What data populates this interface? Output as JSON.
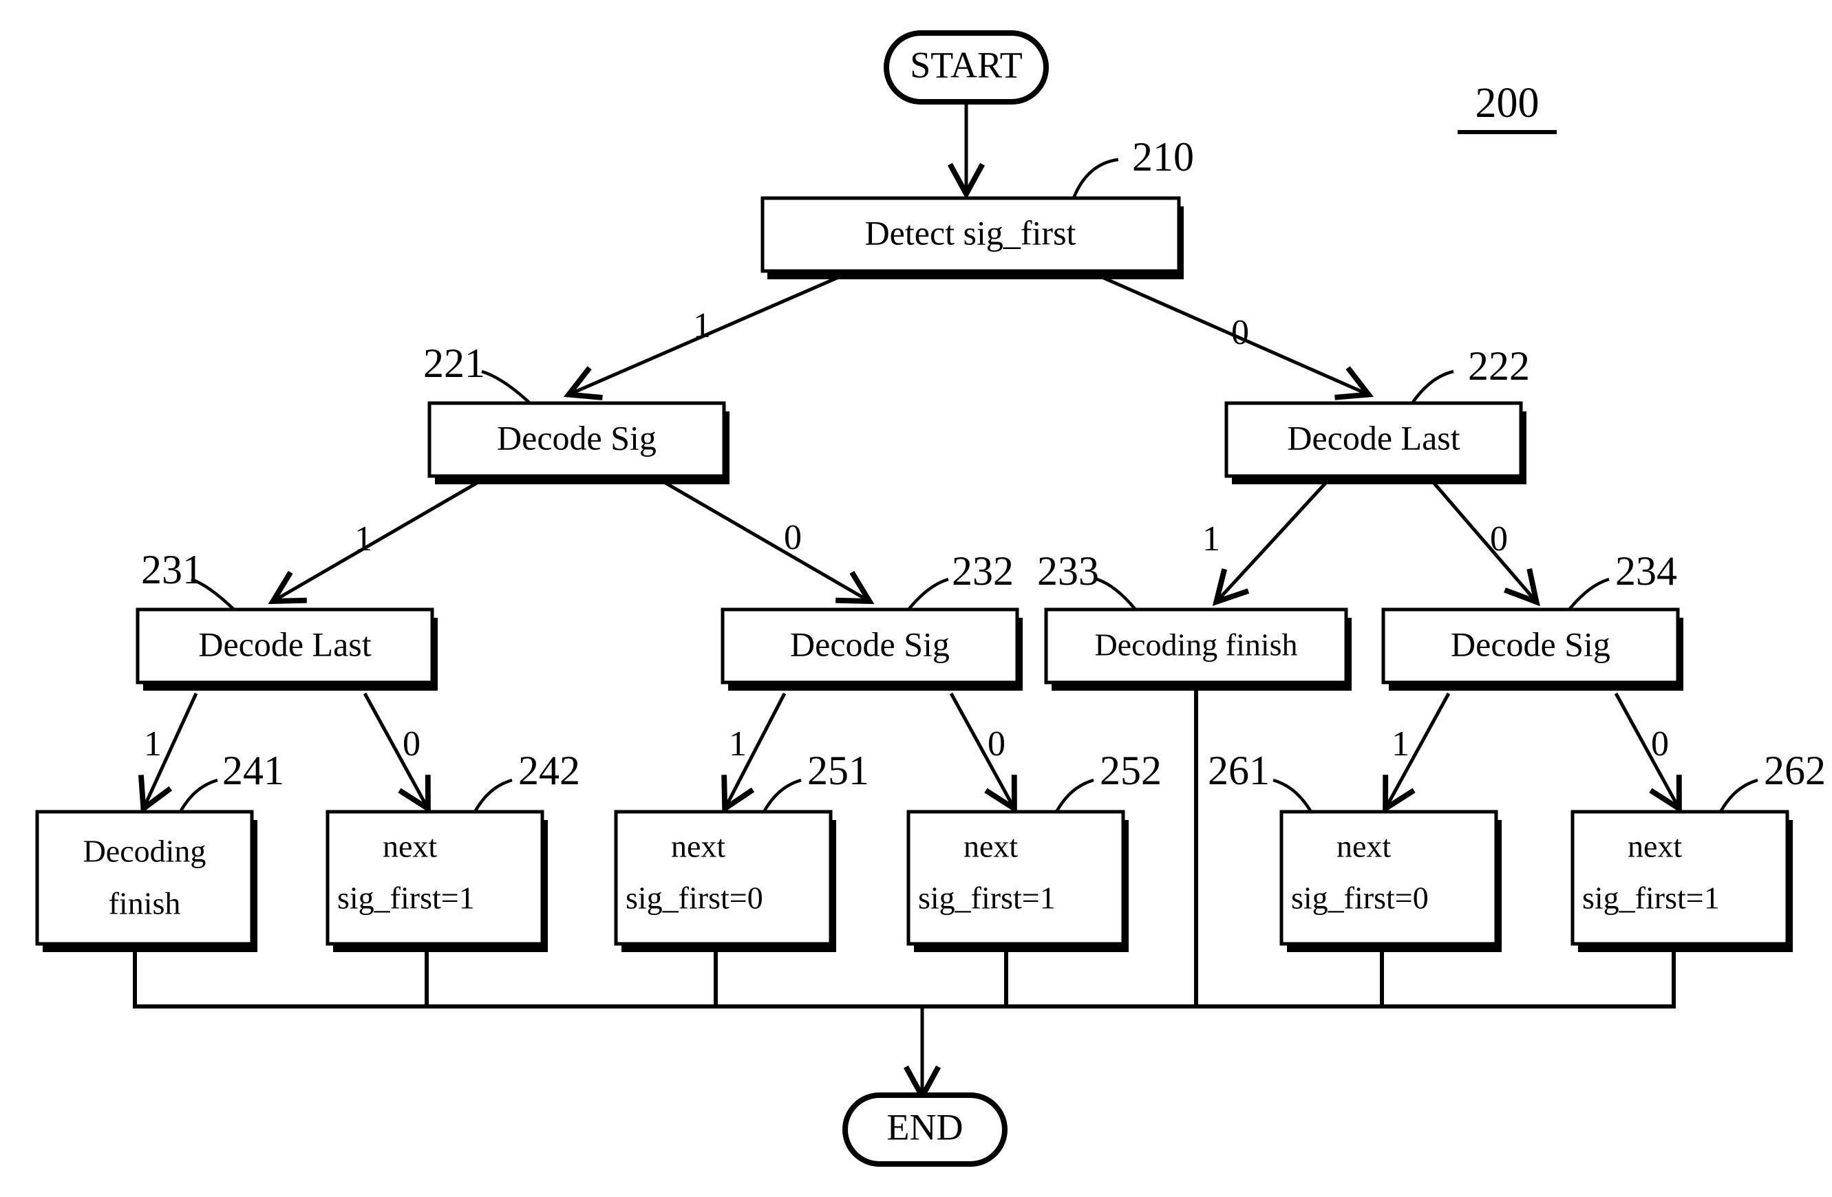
{
  "figure": {
    "number": "200",
    "title_underlined": true
  },
  "terminals": {
    "start": "START",
    "end": "END"
  },
  "nodes": [
    {
      "id": "210",
      "ref": "210",
      "label": "Detect sig_first",
      "lines": [
        "Detect sig_first"
      ]
    },
    {
      "id": "221",
      "ref": "221",
      "label": "Decode Sig",
      "lines": [
        "Decode Sig"
      ]
    },
    {
      "id": "222",
      "ref": "222",
      "label": "Decode Last",
      "lines": [
        "Decode Last"
      ]
    },
    {
      "id": "231",
      "ref": "231",
      "label": "Decode Last",
      "lines": [
        "Decode Last"
      ]
    },
    {
      "id": "232",
      "ref": "232",
      "label": "Decode Sig",
      "lines": [
        "Decode Sig"
      ]
    },
    {
      "id": "233",
      "ref": "233",
      "label": "Decoding finish",
      "lines": [
        "Decoding finish"
      ]
    },
    {
      "id": "234",
      "ref": "234",
      "label": "Decode Sig",
      "lines": [
        "Decode Sig"
      ]
    },
    {
      "id": "241",
      "ref": "241",
      "label": "Decoding finish",
      "lines": [
        "Decoding",
        "finish"
      ]
    },
    {
      "id": "242",
      "ref": "242",
      "label": "next sig_first=1",
      "lines": [
        "next",
        "sig_first=1"
      ]
    },
    {
      "id": "251",
      "ref": "251",
      "label": "next sig_first=0",
      "lines": [
        "next",
        "sig_first=0"
      ]
    },
    {
      "id": "252",
      "ref": "252",
      "label": "next sig_first=1",
      "lines": [
        "next",
        "sig_first=1"
      ]
    },
    {
      "id": "261",
      "ref": "261",
      "label": "next sig_first=0",
      "lines": [
        "next",
        "sig_first=0"
      ]
    },
    {
      "id": "262",
      "ref": "262",
      "label": "next sig_first=1",
      "lines": [
        "next",
        "sig_first=1"
      ]
    }
  ],
  "edges": [
    {
      "from": "START",
      "to": "210",
      "label": ""
    },
    {
      "from": "210",
      "to": "221",
      "label": "1"
    },
    {
      "from": "210",
      "to": "222",
      "label": "0"
    },
    {
      "from": "221",
      "to": "231",
      "label": "1"
    },
    {
      "from": "221",
      "to": "232",
      "label": "0"
    },
    {
      "from": "222",
      "to": "233",
      "label": "1"
    },
    {
      "from": "222",
      "to": "234",
      "label": "0"
    },
    {
      "from": "231",
      "to": "241",
      "label": "1"
    },
    {
      "from": "231",
      "to": "242",
      "label": "0"
    },
    {
      "from": "232",
      "to": "251",
      "label": "1"
    },
    {
      "from": "232",
      "to": "252",
      "label": "0"
    },
    {
      "from": "234",
      "to": "261",
      "label": "1"
    },
    {
      "from": "234",
      "to": "262",
      "label": "0"
    },
    {
      "from": "241",
      "to": "END",
      "label": ""
    },
    {
      "from": "242",
      "to": "END",
      "label": ""
    },
    {
      "from": "233",
      "to": "END",
      "label": ""
    },
    {
      "from": "251",
      "to": "END",
      "label": ""
    },
    {
      "from": "252",
      "to": "END",
      "label": ""
    },
    {
      "from": "261",
      "to": "END",
      "label": ""
    },
    {
      "from": "262",
      "to": "END",
      "label": ""
    }
  ],
  "edge_labels": {
    "e210_221": "1",
    "e210_222": "0",
    "e221_231": "1",
    "e221_232": "0",
    "e222_233": "1",
    "e222_234": "0",
    "e231_241": "1",
    "e231_242": "0",
    "e232_251": "1",
    "e232_252": "0",
    "e234_261": "1",
    "e234_262": "0"
  },
  "refs": {
    "r210": "210",
    "r221": "221",
    "r222": "222",
    "r231": "231",
    "r232": "232",
    "r233": "233",
    "r234": "234",
    "r241": "241",
    "r242": "242",
    "r251": "251",
    "r252": "252",
    "r261": "261",
    "r262": "262"
  },
  "node_text": {
    "n210": "Detect sig_first",
    "n221": "Decode Sig",
    "n222": "Decode Last",
    "n231": "Decode Last",
    "n232": "Decode Sig",
    "n233": "Decoding finish",
    "n234": "Decode Sig",
    "n241_l1": "Decoding",
    "n241_l2": "finish",
    "n242_l1": "next",
    "n242_l2": "sig_first=1",
    "n251_l1": "next",
    "n251_l2": "sig_first=0",
    "n252_l1": "next",
    "n252_l2": "sig_first=1",
    "n261_l1": "next",
    "n261_l2": "sig_first=0",
    "n262_l1": "next",
    "n262_l2": "sig_first=1"
  },
  "colors": {
    "stroke": "#000000",
    "fill": "#ffffff"
  }
}
